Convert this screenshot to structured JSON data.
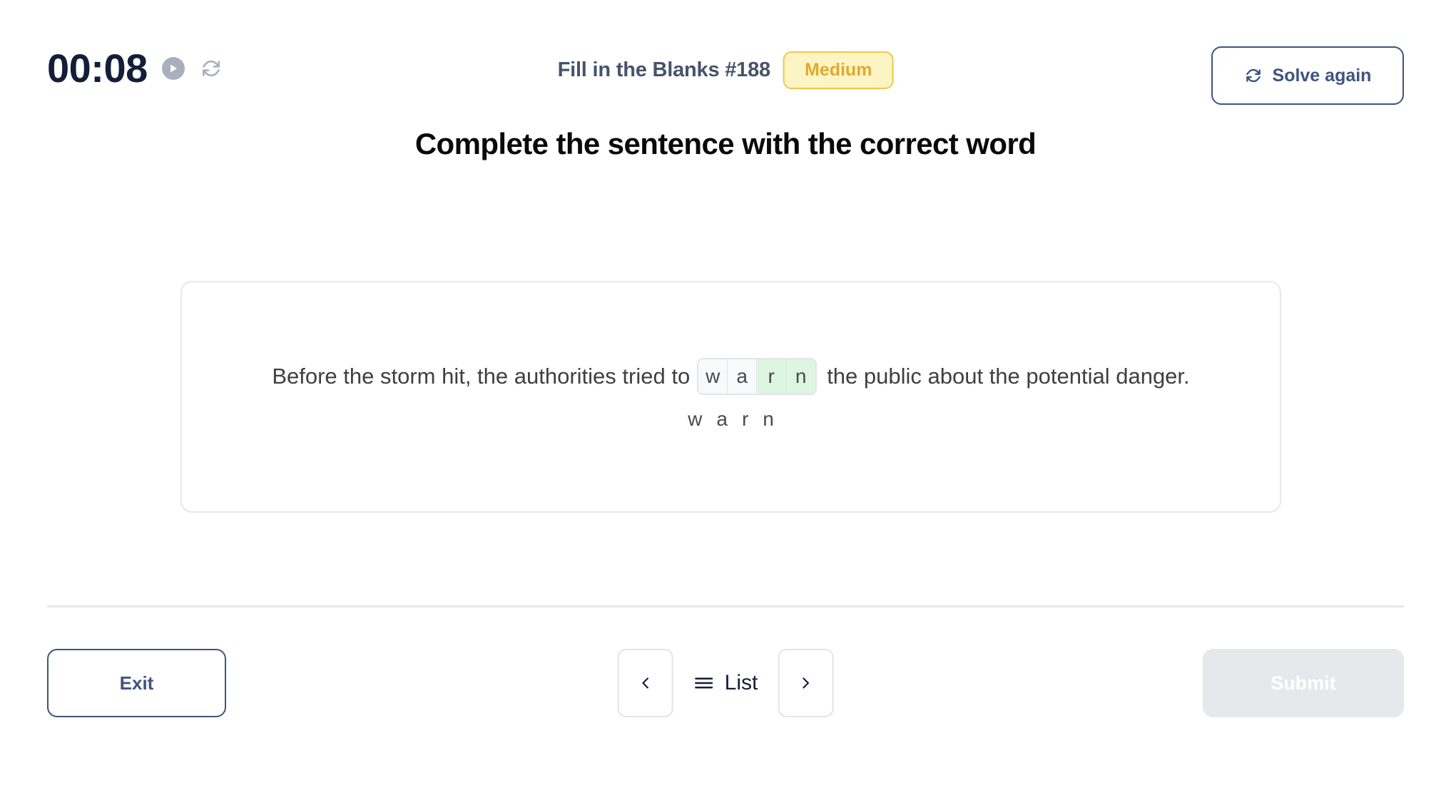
{
  "header": {
    "timer": "00:08",
    "play_icon": "play-icon",
    "reset_icon": "reset-icon",
    "puzzle_title": "Fill in the Blanks #188",
    "difficulty": "Medium",
    "solve_again_label": "Solve again",
    "solve_again_icon": "refresh-icon"
  },
  "prompt": {
    "heading": "Complete the sentence with the correct word"
  },
  "question": {
    "sentence_before": "Before the storm hit, the authorities tried to",
    "sentence_after": "the public about the potential danger.",
    "tiles": [
      {
        "letter": "w",
        "state": "empty"
      },
      {
        "letter": "a",
        "state": "empty"
      },
      {
        "letter": "r",
        "state": "green"
      },
      {
        "letter": "n",
        "state": "green"
      }
    ],
    "hint_letters": [
      "w",
      "a",
      "r",
      "n"
    ]
  },
  "footer": {
    "exit_label": "Exit",
    "prev_icon": "chevron-left-icon",
    "list_icon": "hamburger-icon",
    "list_label": "List",
    "next_icon": "chevron-right-icon",
    "submit_label": "Submit"
  },
  "colors": {
    "navy": "#131f38",
    "slate": "#46536b",
    "accent_blue": "#3e5480",
    "badge_bg": "#fdf4c4",
    "badge_border": "#eec84b",
    "badge_text": "#dfaa2e",
    "tile_green": "#ddf5e1",
    "tile_empty": "#f8f9fb",
    "border_light": "#e7e8ed",
    "submit_disabled_bg": "#e6e8ec"
  }
}
